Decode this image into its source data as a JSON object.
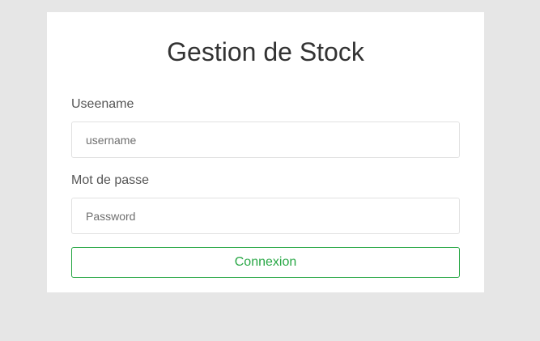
{
  "login": {
    "title": "Gestion de Stock",
    "username_label": "Useename",
    "username_placeholder": "username",
    "username_value": "",
    "password_label": "Mot de passe",
    "password_placeholder": "Password",
    "password_value": "",
    "submit_label": "Connexion"
  },
  "colors": {
    "page_background": "#e6e6e6",
    "card_background": "#ffffff",
    "accent_green": "#28a745",
    "input_border": "#e2e2e2"
  }
}
